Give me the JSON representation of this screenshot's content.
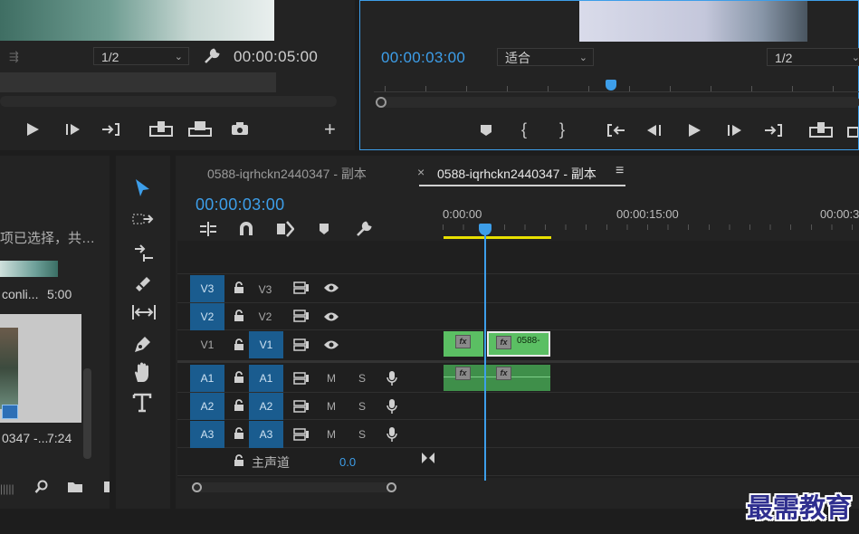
{
  "source_monitor": {
    "zoom": "1/2",
    "duration": "00:00:05:00"
  },
  "program_monitor": {
    "timecode": "00:00:03:00",
    "fit": "适合",
    "zoom": "1/2"
  },
  "project_panel": {
    "selection_text": "项已选择，共…",
    "item1_name": "conli...",
    "item1_duration": "5:00",
    "item2_name": "0347 -...",
    "item2_duration": "7:24"
  },
  "timeline": {
    "tabs": [
      {
        "label": "0588-iqrhckn2440347 - 副本"
      },
      {
        "label": "0588-iqrhckn2440347 - 副本"
      }
    ],
    "close_glyph": "×",
    "menu_glyph": "≡",
    "timecode": "00:00:03:00",
    "ruler": [
      "0:00:00",
      "00:00:15:00",
      "00:00:3"
    ],
    "tracks": {
      "v3": {
        "target": "V3",
        "name": "V3"
      },
      "v2": {
        "target": "V2",
        "name": "V2"
      },
      "v1": {
        "target": "V1",
        "name": "V1"
      },
      "a1": {
        "target": "A1",
        "name": "A1",
        "m": "M",
        "s": "S"
      },
      "a2": {
        "target": "A2",
        "name": "A2",
        "m": "M",
        "s": "S"
      },
      "a3": {
        "target": "A3",
        "name": "A3",
        "m": "M",
        "s": "S"
      }
    },
    "master_label": "主声道",
    "master_value": "0.0",
    "clip_label": "0588-",
    "fx_label": "fx"
  },
  "watermark": "最需教育",
  "colors": {
    "accent": "#3d9ee9",
    "track_target": "#1a5c8f",
    "clip_green": "#5bbf63",
    "work_area": "#e8e000"
  }
}
